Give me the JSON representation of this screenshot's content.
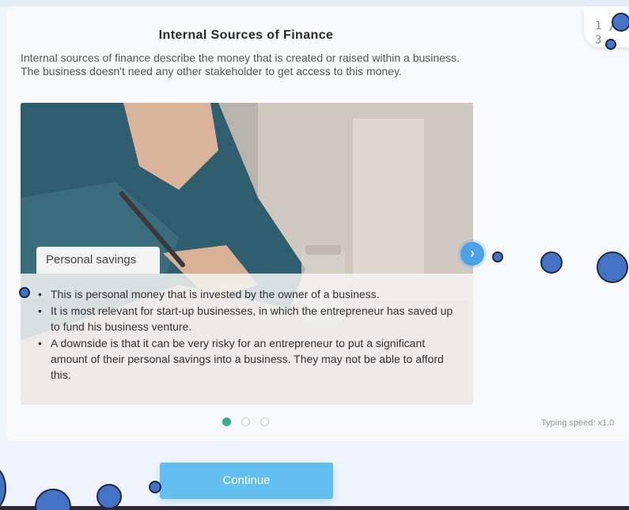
{
  "lesson": {
    "title": "Internal Sources of Finance",
    "intro": "Internal sources of finance describe the money that is created or raised within a business. The business doesn't need any other stakeholder to get access to this money."
  },
  "counter": {
    "current": "1",
    "separator": "/",
    "total": "3"
  },
  "slide": {
    "caption": "Personal savings",
    "bullets": [
      "This is personal money that is invested by the owner of a business.",
      "It is most relevant for start-up businesses, in which the entrepreneur has saved up to fund his business venture.",
      "A downside is that it can be very risky for an entrepreneur to put a significant amount of their personal savings into a business. They may not be able to afford this."
    ],
    "next_icon": "chevron-right-icon"
  },
  "pagination": {
    "count": 3,
    "active_index": 0
  },
  "typing_speed": "Typing speed: x1.0",
  "continue_label": "Continue",
  "colors": {
    "accent_blue": "#62bff0",
    "next_button": "#4aa3e8",
    "active_dot": "#2fb08a",
    "marker": "#4472c4"
  }
}
